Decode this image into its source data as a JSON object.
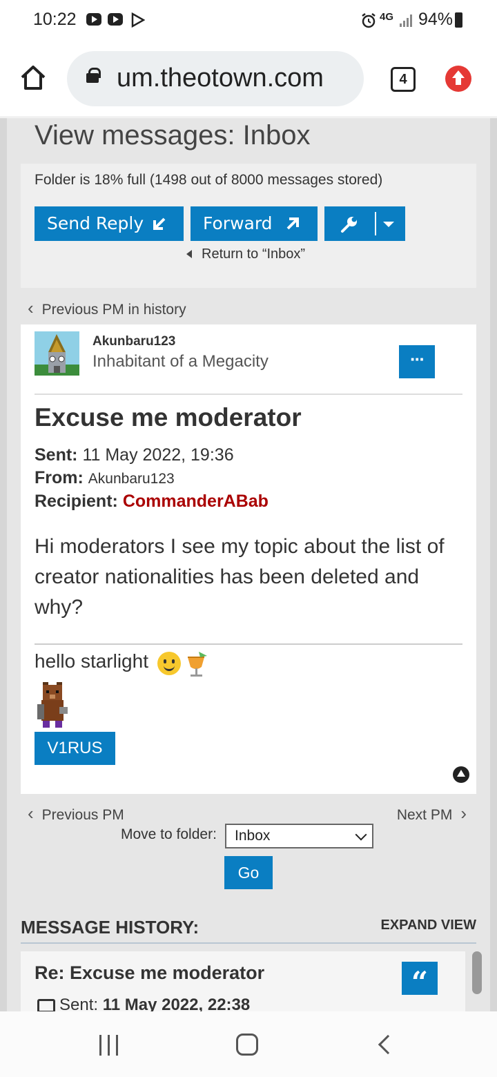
{
  "status_bar": {
    "time": "10:22",
    "network": "4G",
    "battery": "94%"
  },
  "browser": {
    "url": "um.theotown.com",
    "tab_count": "4"
  },
  "page": {
    "title": "View messages: Inbox",
    "folder_status": "Folder is 18% full (1498 out of 8000 messages stored)",
    "buttons": {
      "send_reply": "Send Reply",
      "forward": "Forward"
    },
    "return_link": "Return to “Inbox”",
    "previous_in_history": "Previous PM in history"
  },
  "message": {
    "author": "Akunbaru123",
    "rank": "Inhabitant of a Megacity",
    "more_label": "···",
    "subject": "Excuse me moderator",
    "sent_label": "Sent:",
    "sent_value": "11 May 2022, 19:36",
    "from_label": "From:",
    "from_value": "Akunbaru123",
    "recipient_label": "Recipient:",
    "recipient_value": "CommanderABab",
    "body": "Hi moderators I see my topic about the list of creator nationalities has been deleted and why?",
    "signature_text": "hello starlight",
    "signature_button": "V1RUS"
  },
  "pagination": {
    "previous": "Previous PM",
    "next": "Next PM",
    "move_label": "Move to folder:",
    "folder_selected": "Inbox",
    "go": "Go"
  },
  "history": {
    "title": "MESSAGE HISTORY:",
    "expand": "EXPAND VIEW",
    "item_subject": "Re: Excuse me moderator",
    "item_sent_label": "Sent:",
    "item_sent_value": "11 May 2022, 22:38"
  },
  "colors": {
    "accent": "#0a7ec2",
    "recipient": "#aa0000",
    "alert": "#e53935"
  }
}
